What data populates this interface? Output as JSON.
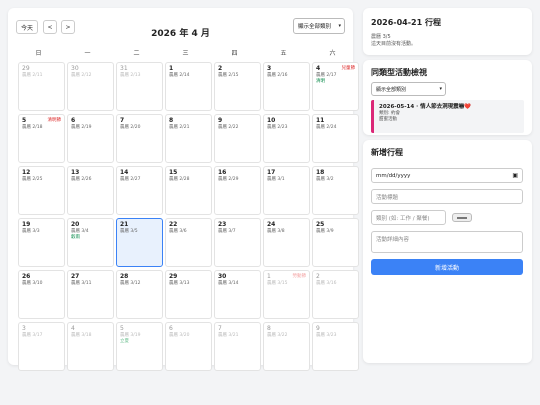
{
  "calendar": {
    "today_label": "今天",
    "prev_label": "<",
    "next_label": ">",
    "title": "2026 年 4 月",
    "filter_label": "顯示全部類別",
    "weekdays": [
      "日",
      "一",
      "二",
      "三",
      "四",
      "五",
      "六"
    ],
    "cells": [
      {
        "d": "29",
        "l": "農曆 2/11",
        "h": "",
        "s": "",
        "other": true
      },
      {
        "d": "30",
        "l": "農曆 2/12",
        "h": "",
        "s": "",
        "other": true
      },
      {
        "d": "31",
        "l": "農曆 2/13",
        "h": "",
        "s": "",
        "other": true
      },
      {
        "d": "1",
        "l": "農曆 2/14",
        "h": "",
        "s": "",
        "other": false
      },
      {
        "d": "2",
        "l": "農曆 2/15",
        "h": "",
        "s": "",
        "other": false
      },
      {
        "d": "3",
        "l": "農曆 2/16",
        "h": "",
        "s": "",
        "other": false
      },
      {
        "d": "4",
        "l": "農曆 2/17",
        "h": "兒童節",
        "s": "清明",
        "other": false
      },
      {
        "d": "5",
        "l": "農曆 2/18",
        "h": "清明節",
        "s": "",
        "other": false
      },
      {
        "d": "6",
        "l": "農曆 2/19",
        "h": "",
        "s": "",
        "other": false
      },
      {
        "d": "7",
        "l": "農曆 2/20",
        "h": "",
        "s": "",
        "other": false
      },
      {
        "d": "8",
        "l": "農曆 2/21",
        "h": "",
        "s": "",
        "other": false
      },
      {
        "d": "9",
        "l": "農曆 2/22",
        "h": "",
        "s": "",
        "other": false
      },
      {
        "d": "10",
        "l": "農曆 2/23",
        "h": "",
        "s": "",
        "other": false
      },
      {
        "d": "11",
        "l": "農曆 2/24",
        "h": "",
        "s": "",
        "other": false
      },
      {
        "d": "12",
        "l": "農曆 2/25",
        "h": "",
        "s": "",
        "other": false
      },
      {
        "d": "13",
        "l": "農曆 2/26",
        "h": "",
        "s": "",
        "other": false
      },
      {
        "d": "14",
        "l": "農曆 2/27",
        "h": "",
        "s": "",
        "other": false
      },
      {
        "d": "15",
        "l": "農曆 2/28",
        "h": "",
        "s": "",
        "other": false
      },
      {
        "d": "16",
        "l": "農曆 2/29",
        "h": "",
        "s": "",
        "other": false
      },
      {
        "d": "17",
        "l": "農曆 3/1",
        "h": "",
        "s": "",
        "other": false
      },
      {
        "d": "18",
        "l": "農曆 3/2",
        "h": "",
        "s": "",
        "other": false
      },
      {
        "d": "19",
        "l": "農曆 3/3",
        "h": "",
        "s": "",
        "other": false
      },
      {
        "d": "20",
        "l": "農曆 3/4",
        "h": "",
        "s": "穀雨",
        "other": false
      },
      {
        "d": "21",
        "l": "農曆 3/5",
        "h": "",
        "s": "",
        "other": false,
        "today": true
      },
      {
        "d": "22",
        "l": "農曆 3/6",
        "h": "",
        "s": "",
        "other": false
      },
      {
        "d": "23",
        "l": "農曆 3/7",
        "h": "",
        "s": "",
        "other": false
      },
      {
        "d": "24",
        "l": "農曆 3/8",
        "h": "",
        "s": "",
        "other": false
      },
      {
        "d": "25",
        "l": "農曆 3/9",
        "h": "",
        "s": "",
        "other": false
      },
      {
        "d": "26",
        "l": "農曆 3/10",
        "h": "",
        "s": "",
        "other": false
      },
      {
        "d": "27",
        "l": "農曆 3/11",
        "h": "",
        "s": "",
        "other": false
      },
      {
        "d": "28",
        "l": "農曆 3/12",
        "h": "",
        "s": "",
        "other": false
      },
      {
        "d": "29",
        "l": "農曆 3/13",
        "h": "",
        "s": "",
        "other": false
      },
      {
        "d": "30",
        "l": "農曆 3/14",
        "h": "",
        "s": "",
        "other": false
      },
      {
        "d": "1",
        "l": "農曆 3/15",
        "h": "勞動節",
        "s": "",
        "other": true
      },
      {
        "d": "2",
        "l": "農曆 3/16",
        "h": "",
        "s": "",
        "other": true
      },
      {
        "d": "3",
        "l": "農曆 3/17",
        "h": "",
        "s": "",
        "other": true
      },
      {
        "d": "4",
        "l": "農曆 3/18",
        "h": "",
        "s": "",
        "other": true
      },
      {
        "d": "5",
        "l": "農曆 3/19",
        "h": "",
        "s": "立夏",
        "other": true
      },
      {
        "d": "6",
        "l": "農曆 3/20",
        "h": "",
        "s": "",
        "other": true
      },
      {
        "d": "7",
        "l": "農曆 3/21",
        "h": "",
        "s": "",
        "other": true
      },
      {
        "d": "8",
        "l": "農曆 3/22",
        "h": "",
        "s": "",
        "other": true
      },
      {
        "d": "9",
        "l": "農曆 3/23",
        "h": "",
        "s": "",
        "other": true
      }
    ]
  },
  "day_panel": {
    "title": "2026-04-21 行程",
    "lunar": "農曆 3/5",
    "empty": "這天目前沒有活動。"
  },
  "similar_panel": {
    "title": "同類型活動檢視",
    "filter_label": "顯示全部類別",
    "event_title": "2026-05-14 · 情人節去洞現震嚇❤️",
    "event_category": "類別: 約會",
    "event_desc": "甜蜜活動",
    "accent_color": "#db2777"
  },
  "new_panel": {
    "title": "新增行程",
    "date_placeholder": "mm/dd/yyyy",
    "title_placeholder": "活動標題",
    "category_placeholder": "類別 (如: 工作 / 聚餐)",
    "desc_placeholder": "活動詳細內容",
    "add_label": "新增活動",
    "button_color": "#3b82f6"
  }
}
